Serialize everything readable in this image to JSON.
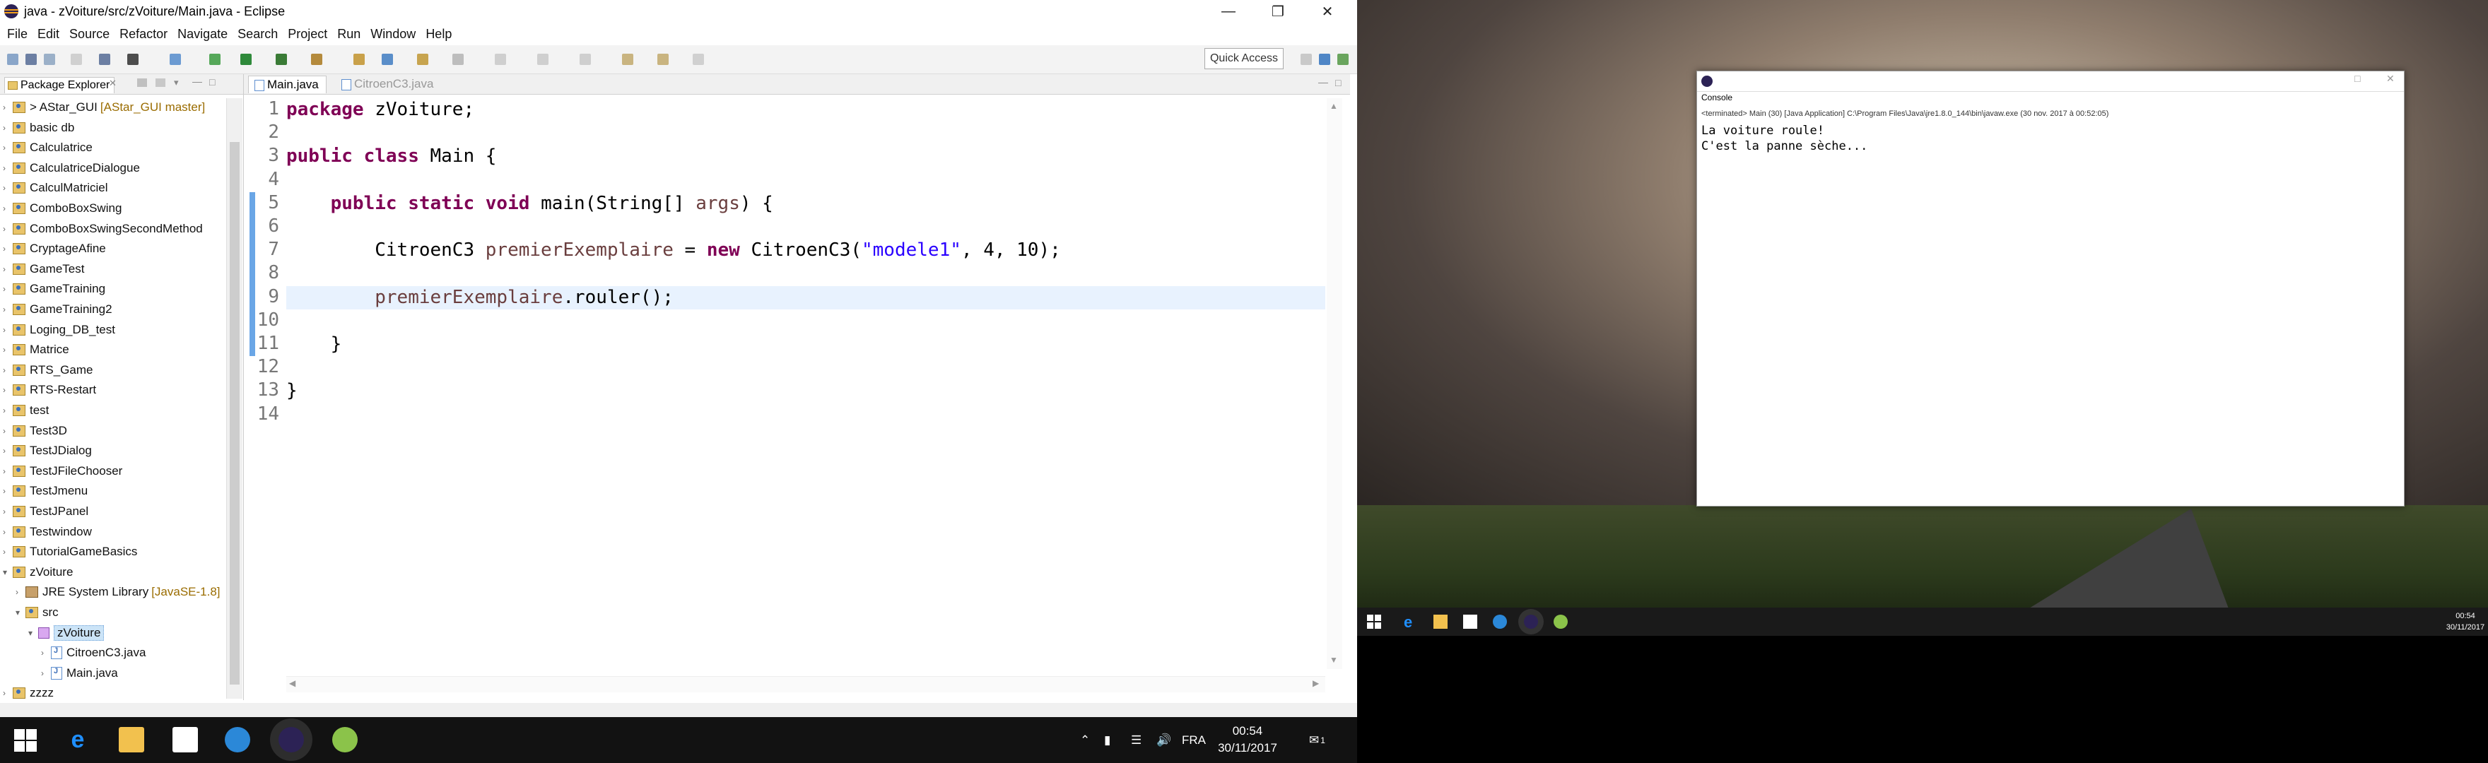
{
  "eclipse": {
    "title": "java - zVoiture/src/zVoiture/Main.java - Eclipse",
    "menu": [
      "File",
      "Edit",
      "Source",
      "Refactor",
      "Navigate",
      "Search",
      "Project",
      "Run",
      "Window",
      "Help"
    ],
    "quick_access": "Quick Access",
    "package_explorer": {
      "tab": "Package Explorer",
      "items": [
        {
          "label": "> AStar_GUI",
          "tag": "[AStar_GUI master]",
          "type": "project",
          "expanded": false
        },
        {
          "label": "basic db",
          "type": "project"
        },
        {
          "label": "Calculatrice",
          "type": "project"
        },
        {
          "label": "CalculatriceDialogue",
          "type": "project"
        },
        {
          "label": "CalculMatriciel",
          "type": "project"
        },
        {
          "label": "ComboBoxSwing",
          "type": "project"
        },
        {
          "label": "ComboBoxSwingSecondMethod",
          "type": "project"
        },
        {
          "label": "CryptageAfine",
          "type": "project"
        },
        {
          "label": "GameTest",
          "type": "project"
        },
        {
          "label": "GameTraining",
          "type": "project"
        },
        {
          "label": "GameTraining2",
          "type": "project"
        },
        {
          "label": "Loging_DB_test",
          "type": "project"
        },
        {
          "label": "Matrice",
          "type": "project"
        },
        {
          "label": "RTS_Game",
          "type": "project"
        },
        {
          "label": "RTS-Restart",
          "type": "project"
        },
        {
          "label": "test",
          "type": "project"
        },
        {
          "label": "Test3D",
          "type": "project"
        },
        {
          "label": "TestJDialog",
          "type": "project"
        },
        {
          "label": "TestJFileChooser",
          "type": "project"
        },
        {
          "label": "TestJmenu",
          "type": "project"
        },
        {
          "label": "TestJPanel",
          "type": "project"
        },
        {
          "label": "Testwindow",
          "type": "project"
        },
        {
          "label": "TutorialGameBasics",
          "type": "project"
        },
        {
          "label": "zVoiture",
          "type": "project",
          "expanded": true
        },
        {
          "label": "JRE System Library",
          "tag": "[JavaSE-1.8]",
          "type": "library",
          "indent": 1
        },
        {
          "label": "src",
          "type": "folder",
          "indent": 1,
          "expanded": true
        },
        {
          "label": "zVoiture",
          "type": "package",
          "indent": 2,
          "expanded": true,
          "selected": true
        },
        {
          "label": "CitroenC3.java",
          "type": "java",
          "indent": 3
        },
        {
          "label": "Main.java",
          "type": "java",
          "indent": 3
        },
        {
          "label": "zzzz",
          "type": "project"
        }
      ]
    },
    "editor": {
      "tabs": [
        {
          "label": "Main.java",
          "active": true
        },
        {
          "label": "CitroenC3.java",
          "active": false
        }
      ],
      "current_line": 9,
      "lines": [
        {
          "no": "1",
          "text": "package zVoiture;"
        },
        {
          "no": "2",
          "text": ""
        },
        {
          "no": "3",
          "text": "public class Main {"
        },
        {
          "no": "4",
          "text": ""
        },
        {
          "no": "5",
          "text": "    public static void main(String[] args) {"
        },
        {
          "no": "6",
          "text": ""
        },
        {
          "no": "7",
          "text": "        CitroenC3 premierExemplaire = new CitroenC3(\"modele1\", 4, 10);"
        },
        {
          "no": "8",
          "text": ""
        },
        {
          "no": "9",
          "text": "        premierExemplaire.rouler();"
        },
        {
          "no": "10",
          "text": ""
        },
        {
          "no": "11",
          "text": "    }"
        },
        {
          "no": "12",
          "text": ""
        },
        {
          "no": "13",
          "text": "}"
        },
        {
          "no": "14",
          "text": ""
        }
      ]
    }
  },
  "taskbar1": {
    "language": "FRA",
    "time": "00:54",
    "date": "30/11/2017",
    "notifications": "1"
  },
  "console": {
    "tab": "Console",
    "info": "<terminated> Main (30) [Java Application] C:\\Program Files\\Java\\jre1.8.0_144\\bin\\javaw.exe (30 nov. 2017 à 00:52:05)",
    "output": [
      "La voiture roule!",
      "C'est la panne sèche..."
    ]
  },
  "taskbar2": {
    "time": "00:54",
    "date": "30/11/2017"
  },
  "colors": {
    "keyword": "#7f0055",
    "variable": "#6a3e3e",
    "string": "#2a00ff",
    "selection": "#cce4f7",
    "current_line": "#e8f2fe"
  }
}
